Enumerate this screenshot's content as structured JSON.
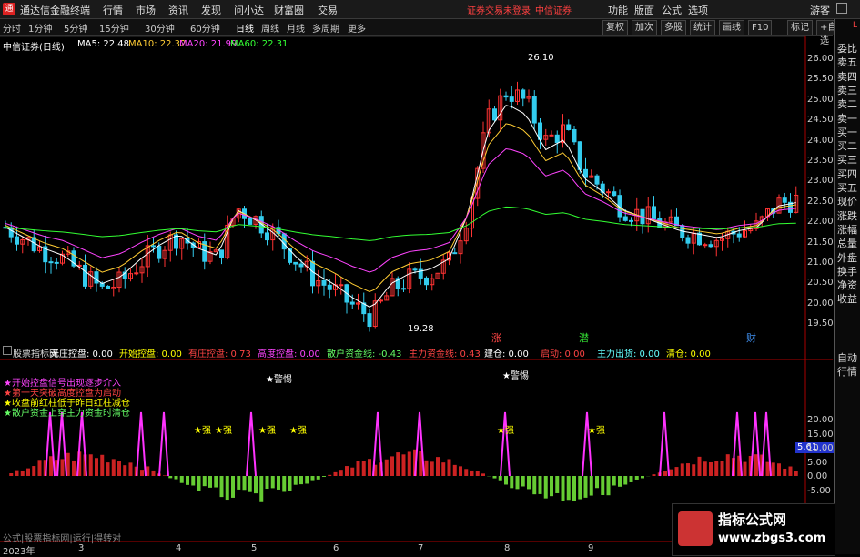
{
  "app": {
    "title": "通达信金融终端",
    "logo": "通"
  },
  "menu": [
    "行情",
    "市场",
    "资讯",
    "发现",
    "问小达",
    "财富圈",
    "交易"
  ],
  "warning": "证券交易未登录",
  "broker": "中信证券",
  "top_right": [
    "功能",
    "版面",
    "公式",
    "选项"
  ],
  "guest": "游客",
  "periods": [
    "分时",
    "1分钟",
    "5分钟",
    "15分钟",
    "30分钟",
    "60分钟",
    "日线",
    "周线",
    "月线",
    "多周期",
    "更多"
  ],
  "tools": [
    "复权",
    "加次",
    "多股",
    "统计",
    "画线",
    "F10",
    "标记",
    "+自选"
  ],
  "stock_title": "中信证券(日线)",
  "ma": [
    {
      "label": "MA5: 22.48",
      "color": "#ffffff"
    },
    {
      "label": "MA10: 22.32",
      "color": "#ffcc33"
    },
    {
      "label": "MA20: 21.99",
      "color": "#ff44ff"
    },
    {
      "label": "MA60: 22.31",
      "color": "#33ff33"
    }
  ],
  "y_labels": [
    "26.00",
    "25.50",
    "25.00",
    "24.50",
    "24.00",
    "23.50",
    "23.00",
    "22.50",
    "22.00",
    "21.50",
    "21.00",
    "20.50",
    "20.00",
    "19.50"
  ],
  "high_label": "26.10",
  "low_label": "19.28",
  "markers": [
    {
      "text": "涨",
      "color": "#ff4444"
    },
    {
      "text": "潜",
      "color": "#33dd33"
    },
    {
      "text": "财",
      "color": "#4499ff"
    }
  ],
  "sub_indicators": [
    {
      "label": "股票指标网",
      "color": "#dddddd"
    },
    {
      "label": "无庄控盘: 0.00",
      "color": "#ffffff"
    },
    {
      "label": "开始控盘: 0.00",
      "color": "#ffff00"
    },
    {
      "label": "有庄控盘: 0.73",
      "color": "#ff4444"
    },
    {
      "label": "高度控盘: 0.00",
      "color": "#ff44ff"
    },
    {
      "label": "散户资金线: -0.43",
      "color": "#66ff66"
    },
    {
      "label": "主力资金线: 0.43",
      "color": "#ff4444"
    },
    {
      "label": "建仓: 0.00",
      "color": "#ffffff"
    },
    {
      "label": "启动: 0.00",
      "color": "#ff4444"
    },
    {
      "label": "主力出货: 0.00",
      "color": "#66ffff"
    },
    {
      "label": "清仓: 0.00",
      "color": "#ffff00"
    }
  ],
  "legend": [
    {
      "text": "开始控盘信号出现逐步介入",
      "color": "#ff44ff"
    },
    {
      "text": "第一天突破高度控盘为启动",
      "color": "#ff4444"
    },
    {
      "text": "收盘前红柱低于昨日红柱减仓",
      "color": "#ffff00"
    },
    {
      "text": "散户资金上穿主力资金时清仓",
      "color": "#66ff66"
    }
  ],
  "alert_label": "警惕",
  "strong_label": "强",
  "sub_y": [
    "20.00",
    "15.00",
    "10.00",
    "5.00",
    "0.00",
    "-5.00"
  ],
  "sub_value": "5.61",
  "footer_note": "公式|股票指标网|运行|得转对",
  "x_labels": [
    "2023年",
    "3",
    "4",
    "5",
    "6",
    "7",
    "8",
    "9"
  ],
  "right_panel": [
    "委比",
    "卖五",
    "卖四",
    "卖三",
    "卖二",
    "卖一",
    "买一",
    "买二",
    "买三",
    "买四",
    "买五",
    "现价",
    "涨跌",
    "涨幅",
    "总量",
    "外盘",
    "换手",
    "净资",
    "收益"
  ],
  "right_panel_bottom": [
    "自动",
    "行情"
  ],
  "watermark_title": "指标公式网",
  "watermark_url": "www.zbgs3.com"
}
